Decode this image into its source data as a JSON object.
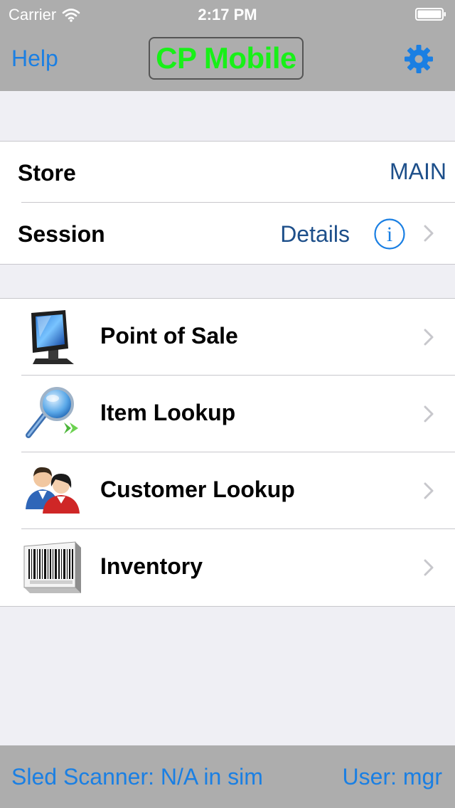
{
  "status_bar": {
    "carrier": "Carrier",
    "time": "2:17 PM"
  },
  "nav": {
    "help_label": "Help",
    "title": "CP Mobile",
    "accent_color": "#1a7fe3",
    "title_color": "#18f018"
  },
  "session_table": {
    "store": {
      "label": "Store",
      "value": "MAIN"
    },
    "session": {
      "label": "Session",
      "value": "Details"
    }
  },
  "menu": {
    "items": [
      {
        "label": "Point of Sale",
        "icon": "pos-terminal-icon"
      },
      {
        "label": "Item Lookup",
        "icon": "magnifier-icon"
      },
      {
        "label": "Customer Lookup",
        "icon": "customers-icon"
      },
      {
        "label": "Inventory",
        "icon": "barcode-icon"
      }
    ]
  },
  "bottom_bar": {
    "scanner_status": "Sled Scanner: N/A in sim",
    "user": "User: mgr"
  }
}
